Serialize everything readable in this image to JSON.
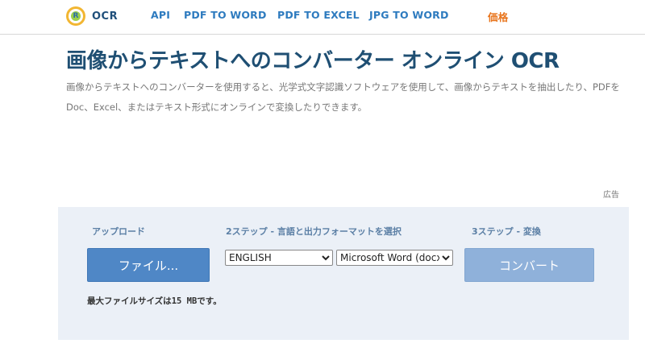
{
  "header": {
    "logo_text": "OCR",
    "logo_mark": "R",
    "nav": {
      "api": "API",
      "pdf_to_word": "PDF TO WORD",
      "pdf_to_excel": "PDF TO EXCEL",
      "jpg_to_word": "JPG TO WORD",
      "price": "価格"
    }
  },
  "main": {
    "title": "画像からテキストへのコンバーター オンライン OCR",
    "description": "画像からテキストへのコンバーターを使用すると、光学式文字認識ソフトウェアを使用して、画像からテキストを抽出したり、PDFをDoc、Excel、またはテキスト形式にオンラインで変換したりできます。",
    "ad_label": "広告"
  },
  "converter": {
    "step1_label": "アップロード",
    "step2_label": "2ステップ - 言語と出力フォーマットを選択",
    "step3_label": "3ステップ - 変換",
    "file_button": "ファイル...",
    "language_selected": "ENGLISH",
    "format_selected": "Microsoft Word (docx)",
    "convert_button": "コンバート",
    "max_size_prefix": "最大ファイルサイズは",
    "max_size_value": "15 MB",
    "max_size_suffix": "です。"
  },
  "colors": {
    "nav_link": "#2e7bbf",
    "nav_price": "#e8761f",
    "title": "#1f4f73",
    "panel_bg": "#ebf0f7",
    "file_button": "#4f87c6",
    "convert_button": "#8fb1da"
  },
  "icons": {
    "logo": "ocr-logo-icon",
    "select_arrow": "chevron-down-icon"
  }
}
